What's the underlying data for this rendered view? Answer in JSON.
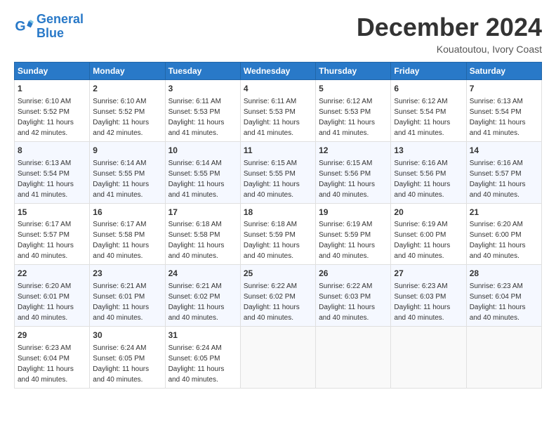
{
  "logo": {
    "line1": "General",
    "line2": "Blue"
  },
  "title": "December 2024",
  "location": "Kouatoutou, Ivory Coast",
  "days_of_week": [
    "Sunday",
    "Monday",
    "Tuesday",
    "Wednesday",
    "Thursday",
    "Friday",
    "Saturday"
  ],
  "weeks": [
    [
      {
        "day": "1",
        "sunrise": "6:10 AM",
        "sunset": "5:52 PM",
        "daylight": "11 hours and 42 minutes."
      },
      {
        "day": "2",
        "sunrise": "6:10 AM",
        "sunset": "5:52 PM",
        "daylight": "11 hours and 42 minutes."
      },
      {
        "day": "3",
        "sunrise": "6:11 AM",
        "sunset": "5:53 PM",
        "daylight": "11 hours and 41 minutes."
      },
      {
        "day": "4",
        "sunrise": "6:11 AM",
        "sunset": "5:53 PM",
        "daylight": "11 hours and 41 minutes."
      },
      {
        "day": "5",
        "sunrise": "6:12 AM",
        "sunset": "5:53 PM",
        "daylight": "11 hours and 41 minutes."
      },
      {
        "day": "6",
        "sunrise": "6:12 AM",
        "sunset": "5:54 PM",
        "daylight": "11 hours and 41 minutes."
      },
      {
        "day": "7",
        "sunrise": "6:13 AM",
        "sunset": "5:54 PM",
        "daylight": "11 hours and 41 minutes."
      }
    ],
    [
      {
        "day": "8",
        "sunrise": "6:13 AM",
        "sunset": "5:54 PM",
        "daylight": "11 hours and 41 minutes."
      },
      {
        "day": "9",
        "sunrise": "6:14 AM",
        "sunset": "5:55 PM",
        "daylight": "11 hours and 41 minutes."
      },
      {
        "day": "10",
        "sunrise": "6:14 AM",
        "sunset": "5:55 PM",
        "daylight": "11 hours and 41 minutes."
      },
      {
        "day": "11",
        "sunrise": "6:15 AM",
        "sunset": "5:55 PM",
        "daylight": "11 hours and 40 minutes."
      },
      {
        "day": "12",
        "sunrise": "6:15 AM",
        "sunset": "5:56 PM",
        "daylight": "11 hours and 40 minutes."
      },
      {
        "day": "13",
        "sunrise": "6:16 AM",
        "sunset": "5:56 PM",
        "daylight": "11 hours and 40 minutes."
      },
      {
        "day": "14",
        "sunrise": "6:16 AM",
        "sunset": "5:57 PM",
        "daylight": "11 hours and 40 minutes."
      }
    ],
    [
      {
        "day": "15",
        "sunrise": "6:17 AM",
        "sunset": "5:57 PM",
        "daylight": "11 hours and 40 minutes."
      },
      {
        "day": "16",
        "sunrise": "6:17 AM",
        "sunset": "5:58 PM",
        "daylight": "11 hours and 40 minutes."
      },
      {
        "day": "17",
        "sunrise": "6:18 AM",
        "sunset": "5:58 PM",
        "daylight": "11 hours and 40 minutes."
      },
      {
        "day": "18",
        "sunrise": "6:18 AM",
        "sunset": "5:59 PM",
        "daylight": "11 hours and 40 minutes."
      },
      {
        "day": "19",
        "sunrise": "6:19 AM",
        "sunset": "5:59 PM",
        "daylight": "11 hours and 40 minutes."
      },
      {
        "day": "20",
        "sunrise": "6:19 AM",
        "sunset": "6:00 PM",
        "daylight": "11 hours and 40 minutes."
      },
      {
        "day": "21",
        "sunrise": "6:20 AM",
        "sunset": "6:00 PM",
        "daylight": "11 hours and 40 minutes."
      }
    ],
    [
      {
        "day": "22",
        "sunrise": "6:20 AM",
        "sunset": "6:01 PM",
        "daylight": "11 hours and 40 minutes."
      },
      {
        "day": "23",
        "sunrise": "6:21 AM",
        "sunset": "6:01 PM",
        "daylight": "11 hours and 40 minutes."
      },
      {
        "day": "24",
        "sunrise": "6:21 AM",
        "sunset": "6:02 PM",
        "daylight": "11 hours and 40 minutes."
      },
      {
        "day": "25",
        "sunrise": "6:22 AM",
        "sunset": "6:02 PM",
        "daylight": "11 hours and 40 minutes."
      },
      {
        "day": "26",
        "sunrise": "6:22 AM",
        "sunset": "6:03 PM",
        "daylight": "11 hours and 40 minutes."
      },
      {
        "day": "27",
        "sunrise": "6:23 AM",
        "sunset": "6:03 PM",
        "daylight": "11 hours and 40 minutes."
      },
      {
        "day": "28",
        "sunrise": "6:23 AM",
        "sunset": "6:04 PM",
        "daylight": "11 hours and 40 minutes."
      }
    ],
    [
      {
        "day": "29",
        "sunrise": "6:23 AM",
        "sunset": "6:04 PM",
        "daylight": "11 hours and 40 minutes."
      },
      {
        "day": "30",
        "sunrise": "6:24 AM",
        "sunset": "6:05 PM",
        "daylight": "11 hours and 40 minutes."
      },
      {
        "day": "31",
        "sunrise": "6:24 AM",
        "sunset": "6:05 PM",
        "daylight": "11 hours and 40 minutes."
      },
      null,
      null,
      null,
      null
    ]
  ]
}
